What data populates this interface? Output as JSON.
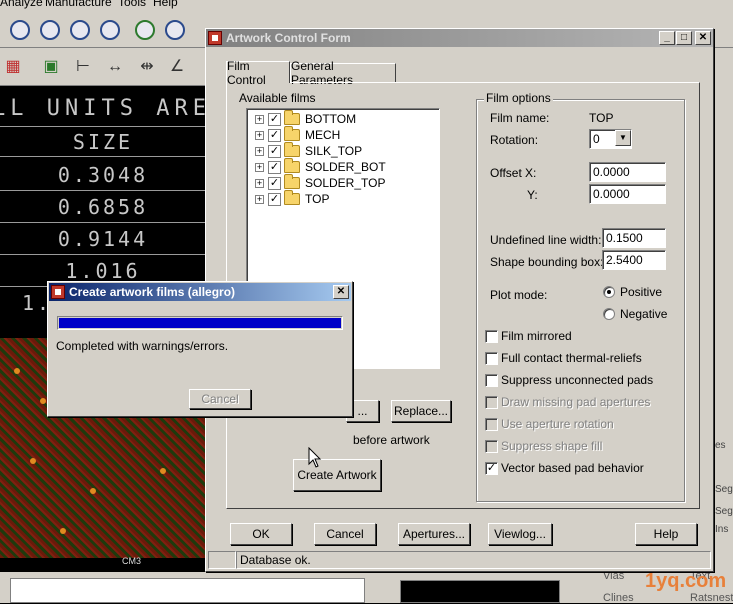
{
  "app": {
    "menu": [
      "Analyze",
      "Manufacture",
      "Tools",
      "Help"
    ],
    "canvas_header": "LL UNITS ARE IN",
    "size_header": "SIZE",
    "sizes": [
      "0.3048",
      "0.6858",
      "0.9144",
      "1.016"
    ],
    "size_row5_partial": "1.",
    "pcb_label": "CM3",
    "right_panel_labels": [
      "es",
      "Seg",
      "Seg",
      "Ins"
    ],
    "bottom_labels": [
      "Vias",
      "Clines"
    ],
    "bottom_right_labels": [
      "Text",
      "Ratsnest"
    ],
    "watermark": "1yq.com"
  },
  "artwork_form": {
    "title": "Artwork Control Form",
    "tabs": [
      {
        "label": "Film Control",
        "active": true
      },
      {
        "label": "General Parameters",
        "active": false
      }
    ],
    "available_films": {
      "label": "Available films",
      "items": [
        "BOTTOM",
        "MECH",
        "SILK_TOP",
        "SOLDER_BOT",
        "SOLDER_TOP",
        "TOP"
      ]
    },
    "left_buttons": {
      "add": "...",
      "replace": "Replace...",
      "check_before": "before artwork",
      "create": "Create Artwork"
    },
    "film_options": {
      "label": "Film options",
      "film_name_label": "Film name:",
      "film_name": "TOP",
      "rotation_label": "Rotation:",
      "rotation": "0",
      "offset_label": "Offset",
      "x_label": "X:",
      "x": "0.0000",
      "y_label": "Y:",
      "y": "0.0000",
      "undefined_line_label": "Undefined line width:",
      "undefined_line": "0.1500",
      "shape_box_label": "Shape bounding box:",
      "shape_box": "2.5400",
      "plot_mode_label": "Plot mode:",
      "positive": "Positive",
      "negative": "Negative",
      "checkboxes": [
        {
          "label": "Film mirrored",
          "checked": false,
          "enabled": true
        },
        {
          "label": "Full contact thermal-reliefs",
          "checked": false,
          "enabled": true
        },
        {
          "label": "Suppress unconnected pads",
          "checked": false,
          "enabled": true
        },
        {
          "label": "Draw missing pad apertures",
          "checked": false,
          "enabled": false
        },
        {
          "label": "Use aperture rotation",
          "checked": false,
          "enabled": false
        },
        {
          "label": "Suppress shape fill",
          "checked": false,
          "enabled": false
        },
        {
          "label": "Vector based pad behavior",
          "checked": true,
          "enabled": true
        }
      ]
    },
    "bottom_buttons": {
      "ok": "OK",
      "cancel": "Cancel",
      "apertures": "Apertures...",
      "viewlog": "Viewlog...",
      "help": "Help"
    },
    "status": "Database ok."
  },
  "progress_dialog": {
    "title": "Create artwork films (allegro)",
    "progress": 1.0,
    "message": "Completed with warnings/errors.",
    "cancel": "Cancel",
    "progress_color": "#0000c8"
  }
}
